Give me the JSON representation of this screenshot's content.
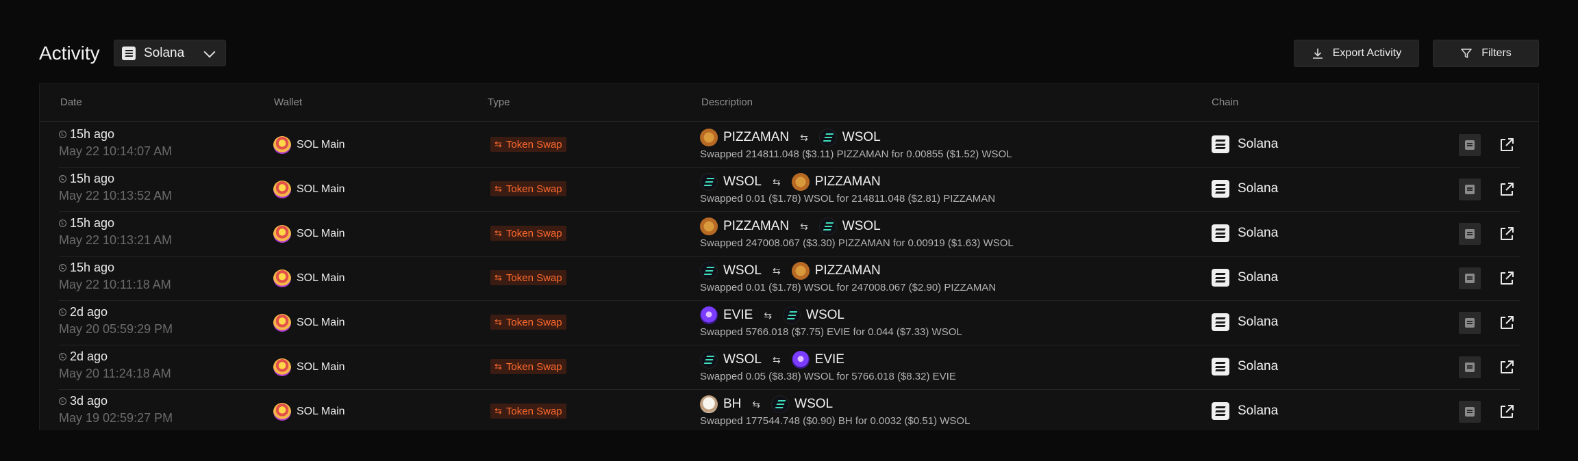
{
  "header": {
    "title": "Activity",
    "chain_select": {
      "value": "Solana",
      "icon": "solana-icon"
    },
    "export_label": "Export Activity",
    "filters_label": "Filters"
  },
  "table": {
    "columns": [
      "Date",
      "Wallet",
      "Type",
      "Description",
      "Chain"
    ],
    "rows": [
      {
        "ago": "15h ago",
        "timestamp": "May 22 10:14:07 AM",
        "wallet": "SOL Main",
        "type": "Token Swap",
        "from_token": "PIZZAMAN",
        "from_icon": "pizza",
        "to_token": "WSOL",
        "to_icon": "wsol",
        "summary": "Swapped 214811.048 ($3.11) PIZZAMAN for 0.00855 ($1.52) WSOL",
        "chain": "Solana"
      },
      {
        "ago": "15h ago",
        "timestamp": "May 22 10:13:52 AM",
        "wallet": "SOL Main",
        "type": "Token Swap",
        "from_token": "WSOL",
        "from_icon": "wsol",
        "to_token": "PIZZAMAN",
        "to_icon": "pizza",
        "summary": "Swapped 0.01 ($1.78) WSOL for 214811.048 ($2.81) PIZZAMAN",
        "chain": "Solana"
      },
      {
        "ago": "15h ago",
        "timestamp": "May 22 10:13:21 AM",
        "wallet": "SOL Main",
        "type": "Token Swap",
        "from_token": "PIZZAMAN",
        "from_icon": "pizza",
        "to_token": "WSOL",
        "to_icon": "wsol",
        "summary": "Swapped 247008.067 ($3.30) PIZZAMAN for 0.00919 ($1.63) WSOL",
        "chain": "Solana"
      },
      {
        "ago": "15h ago",
        "timestamp": "May 22 10:11:18 AM",
        "wallet": "SOL Main",
        "type": "Token Swap",
        "from_token": "WSOL",
        "from_icon": "wsol",
        "to_token": "PIZZAMAN",
        "to_icon": "pizza",
        "summary": "Swapped 0.01 ($1.78) WSOL for 247008.067 ($2.90) PIZZAMAN",
        "chain": "Solana"
      },
      {
        "ago": "2d ago",
        "timestamp": "May 20 05:59:29 PM",
        "wallet": "SOL Main",
        "type": "Token Swap",
        "from_token": "EVIE",
        "from_icon": "evie",
        "to_token": "WSOL",
        "to_icon": "wsol",
        "summary": "Swapped 5766.018 ($7.75) EVIE for 0.044 ($7.33) WSOL",
        "chain": "Solana"
      },
      {
        "ago": "2d ago",
        "timestamp": "May 20 11:24:18 AM",
        "wallet": "SOL Main",
        "type": "Token Swap",
        "from_token": "WSOL",
        "from_icon": "wsol",
        "to_token": "EVIE",
        "to_icon": "evie",
        "summary": "Swapped 0.05 ($8.38) WSOL for 5766.018 ($8.32) EVIE",
        "chain": "Solana"
      },
      {
        "ago": "3d ago",
        "timestamp": "May 19 02:59:27 PM",
        "wallet": "SOL Main",
        "type": "Token Swap",
        "from_token": "BH",
        "from_icon": "bh",
        "to_token": "WSOL",
        "to_icon": "wsol",
        "summary": "Swapped 177544.748 ($0.90) BH for 0.0032 ($0.51) WSOL",
        "chain": "Solana"
      }
    ]
  },
  "colors": {
    "accent": "#ff6a2e",
    "badge_bg": "#3b1c12",
    "background": "#0a0a0a"
  }
}
